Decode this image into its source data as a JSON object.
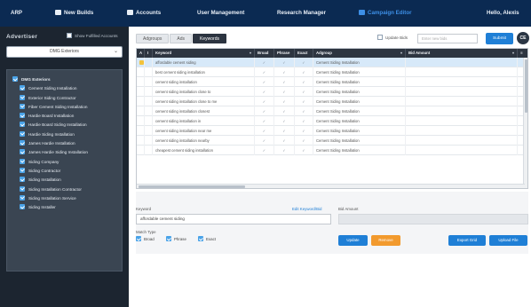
{
  "topnav": {
    "items": [
      {
        "label": "ARP",
        "icon": ""
      },
      {
        "label": "New Builds",
        "icon": "tools-icon"
      },
      {
        "label": "Accounts",
        "icon": "building-icon"
      },
      {
        "label": "User Management",
        "icon": ""
      },
      {
        "label": "Research Manager",
        "icon": ""
      },
      {
        "label": "Campaign Editor",
        "icon": "edit-icon"
      },
      {
        "label": "Hello, Alexis",
        "icon": ""
      }
    ],
    "active_index": 5,
    "colors": {
      "bg": "#0b2a52",
      "active": "#3d8fe6"
    }
  },
  "sidebar": {
    "advertiser_label": "Advertiser",
    "show_unfulfilled_label": "Show Fulfilled Accounts",
    "advertiser_value": "DMG Exteriors",
    "tree": [
      {
        "label": "DMG Exteriors",
        "level": 0
      },
      {
        "label": "Cement Siding Installation",
        "level": 1
      },
      {
        "label": "Exterior Siding Contractor",
        "level": 1
      },
      {
        "label": "Fiber Cement Siding Installation",
        "level": 1
      },
      {
        "label": "Hardie Board Installation",
        "level": 1
      },
      {
        "label": "Hardie Board Siding Installation",
        "level": 1
      },
      {
        "label": "Hardie Siding Installation",
        "level": 1
      },
      {
        "label": "James Hardie Installation",
        "level": 1
      },
      {
        "label": "James Hardie Siding Installation",
        "level": 1
      },
      {
        "label": "Siding Company",
        "level": 1
      },
      {
        "label": "Siding Contractor",
        "level": 1
      },
      {
        "label": "Siding Installation",
        "level": 1
      },
      {
        "label": "Siding Installation Contractor",
        "level": 1
      },
      {
        "label": "Siding Installation Service",
        "level": 1
      },
      {
        "label": "Siding Installer",
        "level": 1
      }
    ]
  },
  "main": {
    "tabs": [
      "Adgroups",
      "Ads",
      "Keywords"
    ],
    "active_tab": 2,
    "update_bids_label": "Update Bids",
    "bid_placeholder": "Enter new bids",
    "submit_label": "Submit",
    "round_button_label": "CE",
    "grid": {
      "columns": [
        "A",
        "I",
        "Keyword",
        "Broad",
        "Phrase",
        "Exact",
        "Adgroup",
        "Bid Amount",
        ""
      ],
      "rows": [
        {
          "keyword": "affordable cement siding",
          "broad": "✓",
          "phrase": "✓",
          "exact": "✓",
          "adgroup": "Cement Siding Installation",
          "bid": "",
          "selected": true,
          "flag": true
        },
        {
          "keyword": "best cement siding installation",
          "broad": "✓",
          "phrase": "✓",
          "exact": "✓",
          "adgroup": "Cement Siding Installation",
          "bid": "",
          "selected": false,
          "flag": false
        },
        {
          "keyword": "cement siding installation",
          "broad": "✓",
          "phrase": "✓",
          "exact": "✓",
          "adgroup": "Cement Siding Installation",
          "bid": "",
          "selected": false,
          "flag": false
        },
        {
          "keyword": "cement siding installation close to",
          "broad": "✓",
          "phrase": "✓",
          "exact": "✓",
          "adgroup": "Cement Siding Installation",
          "bid": "",
          "selected": false,
          "flag": false
        },
        {
          "keyword": "cement siding installation close to me",
          "broad": "✓",
          "phrase": "✓",
          "exact": "✓",
          "adgroup": "Cement Siding Installation",
          "bid": "",
          "selected": false,
          "flag": false
        },
        {
          "keyword": "cement siding installation closest",
          "broad": "✓",
          "phrase": "✓",
          "exact": "✓",
          "adgroup": "Cement Siding Installation",
          "bid": "",
          "selected": false,
          "flag": false
        },
        {
          "keyword": "cement siding installation in",
          "broad": "✓",
          "phrase": "✓",
          "exact": "✓",
          "adgroup": "Cement Siding Installation",
          "bid": "",
          "selected": false,
          "flag": false
        },
        {
          "keyword": "cement siding installation near me",
          "broad": "✓",
          "phrase": "✓",
          "exact": "✓",
          "adgroup": "Cement Siding Installation",
          "bid": "",
          "selected": false,
          "flag": false
        },
        {
          "keyword": "cement siding installation nearby",
          "broad": "✓",
          "phrase": "✓",
          "exact": "✓",
          "adgroup": "Cement Siding Installation",
          "bid": "",
          "selected": false,
          "flag": false
        },
        {
          "keyword": "cheapest cement siding installation",
          "broad": "✓",
          "phrase": "✓",
          "exact": "✓",
          "adgroup": "Cement Siding Installation",
          "bid": "",
          "selected": false,
          "flag": false
        }
      ]
    },
    "edit": {
      "keyword_label": "Keyword",
      "edit_label": "Edit Keyword/Bid",
      "bid_amount_label": "Bid Amount",
      "keyword_value": "affordable cement siding",
      "match_type_label": "Match Type",
      "match_types": [
        "Broad",
        "Phrase",
        "Exact"
      ],
      "buttons": {
        "update": "Update",
        "remove": "Remove",
        "export": "Export Grid",
        "upload": "Upload File"
      }
    }
  }
}
